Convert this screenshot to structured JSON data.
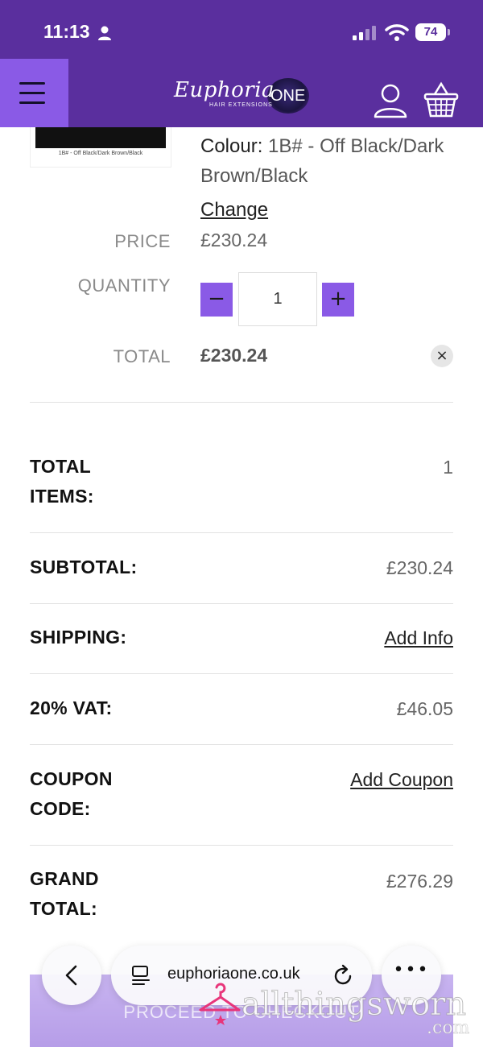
{
  "status_bar": {
    "time": "11:13",
    "battery": "74"
  },
  "header": {
    "logo_script": "Euphoria",
    "logo_sub": "HAIR EXTENSIONS",
    "logo_one": "ONE"
  },
  "item": {
    "thumb_caption": "1B# - Off Black/Dark Brown/Black",
    "colour_label": "Colour:",
    "colour_value": "1B# - Off Black/Dark Brown/Black",
    "change_link": "Change",
    "price_label": "PRICE",
    "price_value": "£230.24",
    "quantity_label": "QUANTITY",
    "quantity_value": "1",
    "decrement": "−",
    "increment": "+",
    "total_label": "TOTAL",
    "total_value": "£230.24",
    "remove": "×"
  },
  "summary": {
    "total_items_label": "TOTAL ITEMS:",
    "total_items_value": "1",
    "subtotal_label": "SUBTOTAL:",
    "subtotal_value": "£230.24",
    "shipping_label": "SHIPPING:",
    "shipping_link": "Add Info",
    "vat_label": "20% VAT:",
    "vat_value": "£46.05",
    "coupon_label": "COUPON CODE:",
    "coupon_link": "Add Coupon",
    "grand_total_label": "GRAND TOTAL:",
    "grand_total_value": "£276.29"
  },
  "checkout": {
    "label": "PROCEED TO CHECKOUT"
  },
  "browser": {
    "url": "euphoriaone.co.uk",
    "more": "•••"
  },
  "watermark": {
    "text": "allthingsworn",
    "suffix": ".com"
  },
  "colors": {
    "brand_purple": "#5a2f9e",
    "accent_purple": "#8a5ae6"
  }
}
